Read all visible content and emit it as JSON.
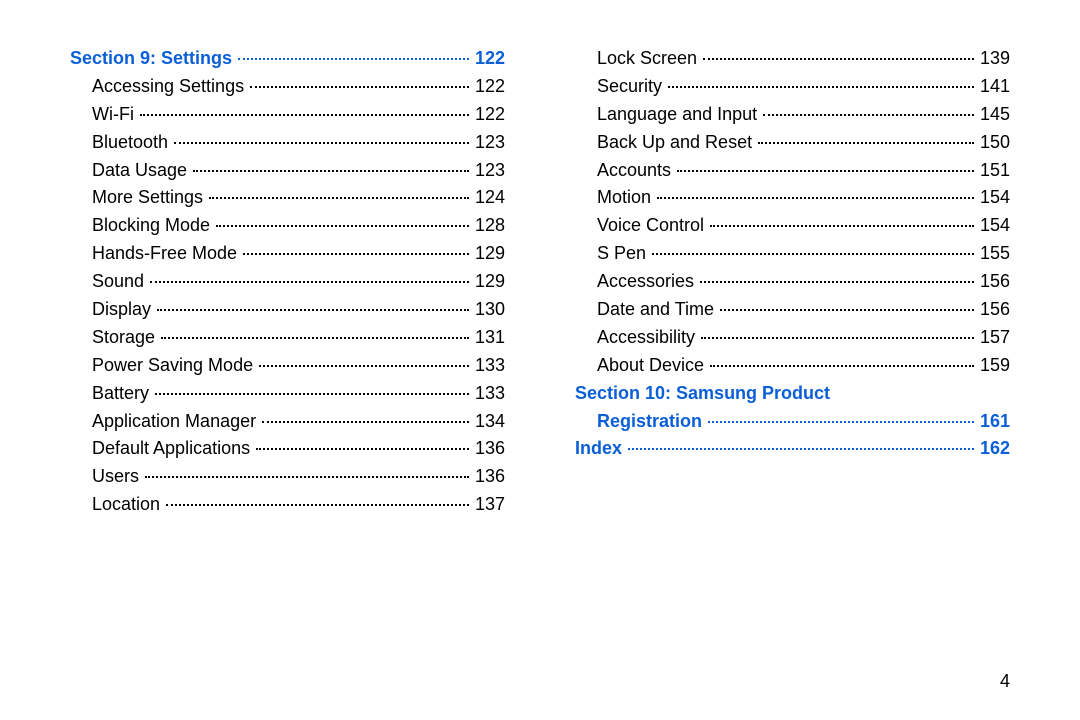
{
  "page_number": "4",
  "columns": [
    [
      {
        "type": "section",
        "label": "Section 9:  Settings",
        "page": "122"
      },
      {
        "type": "item",
        "label": "Accessing Settings",
        "page": "122"
      },
      {
        "type": "item",
        "label": "Wi-Fi",
        "page": "122"
      },
      {
        "type": "item",
        "label": "Bluetooth",
        "page": "123"
      },
      {
        "type": "item",
        "label": "Data Usage",
        "page": "123"
      },
      {
        "type": "item",
        "label": "More Settings",
        "page": "124"
      },
      {
        "type": "item",
        "label": "Blocking Mode",
        "page": "128"
      },
      {
        "type": "item",
        "label": "Hands-Free Mode",
        "page": "129"
      },
      {
        "type": "item",
        "label": "Sound",
        "page": "129"
      },
      {
        "type": "item",
        "label": "Display",
        "page": "130"
      },
      {
        "type": "item",
        "label": "Storage",
        "page": "131"
      },
      {
        "type": "item",
        "label": "Power Saving Mode",
        "page": "133"
      },
      {
        "type": "item",
        "label": "Battery",
        "page": "133"
      },
      {
        "type": "item",
        "label": "Application Manager",
        "page": "134"
      },
      {
        "type": "item",
        "label": "Default Applications",
        "page": "136"
      },
      {
        "type": "item",
        "label": "Users",
        "page": "136"
      },
      {
        "type": "item",
        "label": "Location",
        "page": "137"
      }
    ],
    [
      {
        "type": "item",
        "label": "Lock Screen",
        "page": "139"
      },
      {
        "type": "item",
        "label": "Security",
        "page": "141"
      },
      {
        "type": "item",
        "label": "Language and Input",
        "page": "145"
      },
      {
        "type": "item",
        "label": "Back Up and Reset",
        "page": "150"
      },
      {
        "type": "item",
        "label": "Accounts",
        "page": "151"
      },
      {
        "type": "item",
        "label": "Motion",
        "page": "154"
      },
      {
        "type": "item",
        "label": "Voice Control",
        "page": "154"
      },
      {
        "type": "item",
        "label": "S Pen",
        "page": "155"
      },
      {
        "type": "item",
        "label": "Accessories",
        "page": "156"
      },
      {
        "type": "item",
        "label": "Date and Time",
        "page": "156"
      },
      {
        "type": "item",
        "label": "Accessibility",
        "page": "157"
      },
      {
        "type": "item",
        "label": "About Device",
        "page": "159"
      },
      {
        "type": "section-multiline",
        "line1": "Section 10:  Samsung Product",
        "line2": "Registration",
        "page": "161"
      },
      {
        "type": "section",
        "label": "Index",
        "page": "162"
      }
    ]
  ]
}
